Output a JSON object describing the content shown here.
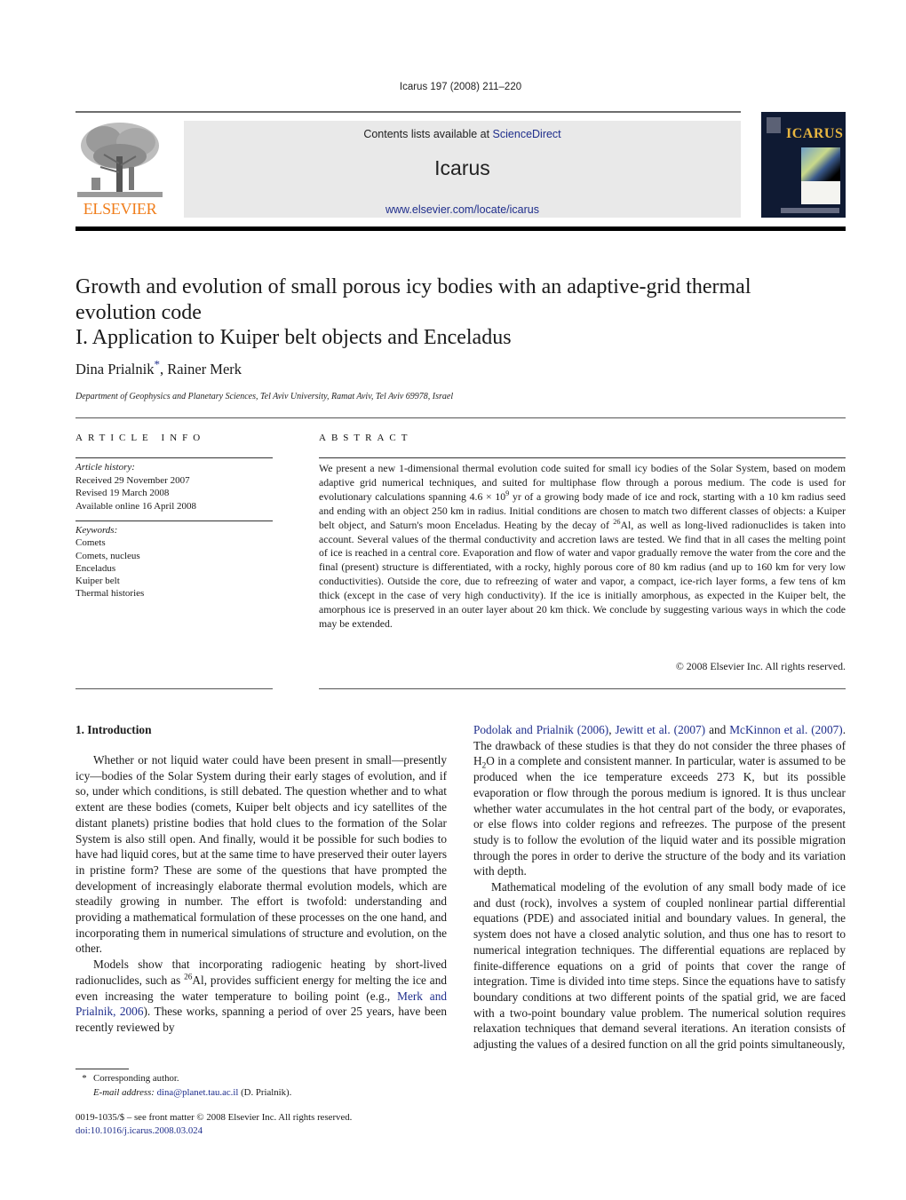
{
  "header": {
    "journal_ref": "Icarus 197 (2008) 211–220",
    "contents_prefix": "Contents lists available at ",
    "sciencedirect_label": "ScienceDirect",
    "journal_name": "Icarus",
    "journal_url": "www.elsevier.com/locate/icarus",
    "publisher_logo_text": "ELSEVIER",
    "cover_title": "ICARUS",
    "colors": {
      "elsevier_orange": "#f07d1a",
      "link_blue": "#1f2e8c",
      "box_grey": "#e9e9e9"
    }
  },
  "article": {
    "title_lines": [
      "Growth and evolution of small porous icy bodies with an adaptive-grid thermal",
      "evolution code",
      "I. Application to Kuiper belt objects and Enceladus"
    ],
    "authors": [
      {
        "name": "Dina Prialnik",
        "marker": "*"
      },
      {
        "name": "Rainer Merk",
        "marker": ""
      }
    ],
    "author_separator": ", ",
    "affiliation": "Department of Geophysics and Planetary Sciences, Tel Aviv University, Ramat Aviv, Tel Aviv 69978, Israel"
  },
  "article_info": {
    "heading": "ARTICLE INFO",
    "history_label": "Article history:",
    "history": [
      "Received 29 November 2007",
      "Revised 19 March 2008",
      "Available online 16 April 2008"
    ],
    "keywords_label": "Keywords:",
    "keywords": [
      "Comets",
      "Comets, nucleus",
      "Enceladus",
      "Kuiper belt",
      "Thermal histories"
    ]
  },
  "abstract": {
    "heading": "ABSTRACT",
    "part1": "We present a new 1-dimensional thermal evolution code suited for small icy bodies of the Solar System, based on modem adaptive grid numerical techniques, and suited for multiphase flow through a porous medium. The code is used for evolutionary calculations spanning 4.6 × 10",
    "sup1": "9",
    "part2": " yr of a growing body made of ice and rock, starting with a 10 km radius seed and ending with an object 250 km in radius. Initial conditions are chosen to match two different classes of objects: a Kuiper belt object, and Saturn's moon Enceladus. Heating by the decay of ",
    "sup2": "26",
    "part3": "Al, as well as long-lived radionuclides is taken into account. Several values of the thermal conductivity and accretion laws are tested. We find that in all cases the melting point of ice is reached in a central core. Evaporation and flow of water and vapor gradually remove the water from the core and the final (present) structure is differentiated, with a rocky, highly porous core of 80 km radius (and up to 160 km for very low conductivities). Outside the core, due to refreezing of water and vapor, a compact, ice-rich layer forms, a few tens of km thick (except in the case of very high conductivity). If the ice is initially amorphous, as expected in the Kuiper belt, the amorphous ice is preserved in an outer layer about 20 km thick. We conclude by suggesting various ways in which the code may be extended.",
    "copyright": "© 2008 Elsevier Inc. All rights reserved."
  },
  "body": {
    "section_heading": "1.  Introduction",
    "left": {
      "p1": "Whether or not liquid water could have been present in small—presently icy—bodies of the Solar System during their early stages of evolution, and if so, under which conditions, is still debated. The question whether and to what extent are these bodies (comets, Kuiper belt objects and icy satellites of the distant planets) pristine bodies that hold clues to the formation of the Solar System is also still open. And finally, would it be possible for such bodies to have had liquid cores, but at the same time to have preserved their outer layers in pristine form? These are some of the questions that have prompted the development of increasingly elaborate thermal evolution models, which are steadily growing in number. The effort is twofold: understanding and providing a mathematical formulation of these processes on the one hand, and incorporating them in numerical simulations of structure and evolution, on the other.",
      "p2_a": "Models show that incorporating radiogenic heating by short-lived radionuclides, such as ",
      "p2_sup": "26",
      "p2_b": "Al, provides sufficient energy for melting the ice and even increasing the water temperature to boiling point (e.g., ",
      "p2_link": "Merk and Prialnik, 2006",
      "p2_c": "). These works, spanning a period of over 25 years, have been recently reviewed by"
    },
    "right": {
      "link1": "Podolak and Prialnik (2006)",
      "sep1": ", ",
      "link2": "Jewitt et al. (2007)",
      "sep2": " and ",
      "link3": "McKinnon et al. (2007)",
      "p1_a": ". The drawback of these studies is that they do not consider the three phases of H",
      "p1_sub": "2",
      "p1_b": "O in a complete and consistent manner. In particular, water is assumed to be produced when the ice temperature exceeds 273 K, but its possible evaporation or flow through the porous medium is ignored. It is thus unclear whether water accumulates in the hot central part of the body, or evaporates, or else flows into colder regions and refreezes. The purpose of the present study is to follow the evolution of the liquid water and its possible migration through the pores in order to derive the structure of the body and its variation with depth.",
      "p2": "Mathematical modeling of the evolution of any small body made of ice and dust (rock), involves a system of coupled nonlinear partial differential equations (PDE) and associated initial and boundary values. In general, the system does not have a closed analytic solution, and thus one has to resort to numerical integration techniques. The differential equations are replaced by finite-difference equations on a grid of points that cover the range of integration. Time is divided into time steps. Since the equations have to satisfy boundary conditions at two different points of the spatial grid, we are faced with a two-point boundary value problem. The numerical solution requires relaxation techniques that demand several iterations. An iteration consists of adjusting the values of a desired function on all the grid points simultaneously,"
    }
  },
  "footnotes": {
    "star": "*",
    "corresponding": "Corresponding author.",
    "email_label": "E-mail address:",
    "email": "dina@planet.tau.ac.il",
    "email_suffix": " (D. Prialnik).",
    "front_matter": "0019-1035/$ – see front matter  © 2008 Elsevier Inc. All rights reserved.",
    "doi": "doi:10.1016/j.icarus.2008.03.024"
  }
}
